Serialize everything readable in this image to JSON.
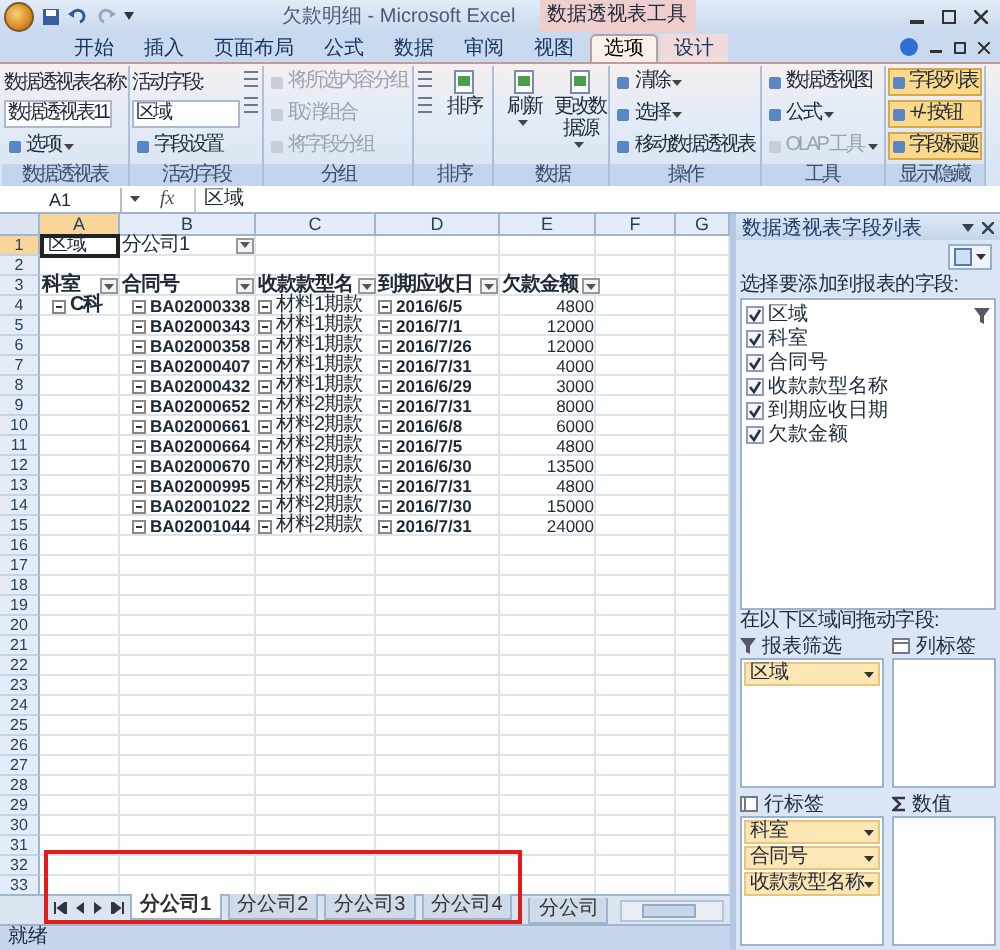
{
  "window": {
    "title": "欠款明细 - Microsoft Excel",
    "contextual_title": "数据透视表工具"
  },
  "ribbon_tabs": [
    {
      "label": "开始",
      "selected": false,
      "contextual": false
    },
    {
      "label": "插入",
      "selected": false,
      "contextual": false
    },
    {
      "label": "页面布局",
      "selected": false,
      "contextual": false
    },
    {
      "label": "公式",
      "selected": false,
      "contextual": false
    },
    {
      "label": "数据",
      "selected": false,
      "contextual": false
    },
    {
      "label": "审阅",
      "selected": false,
      "contextual": false
    },
    {
      "label": "视图",
      "selected": false,
      "contextual": false
    },
    {
      "label": "选项",
      "selected": true,
      "contextual": true
    },
    {
      "label": "设计",
      "selected": false,
      "contextual": true
    }
  ],
  "ribbon_groups": [
    {
      "label": "数据透视表",
      "columns": [
        [
          {
            "kind": "text",
            "label": "数据透视表名称:"
          },
          {
            "kind": "field",
            "value": "数据透视表11"
          },
          {
            "kind": "button",
            "label": "选项",
            "dropdown": true,
            "disabled": false,
            "selected": false
          }
        ]
      ]
    },
    {
      "label": "活动字段",
      "columns": [
        [
          {
            "kind": "text",
            "label": "活动字段:"
          },
          {
            "kind": "field",
            "value": "区域"
          },
          {
            "kind": "button",
            "label": "字段设置",
            "dropdown": false,
            "disabled": false,
            "selected": false
          }
        ],
        [
          {
            "kind": "icon"
          },
          {
            "kind": "icon"
          }
        ]
      ]
    },
    {
      "label": "分组",
      "columns": [
        [
          {
            "kind": "button",
            "label": "将所选内容分组",
            "dropdown": false,
            "disabled": true,
            "selected": false
          },
          {
            "kind": "button",
            "label": "取消组合",
            "dropdown": false,
            "disabled": true,
            "selected": false
          },
          {
            "kind": "button",
            "label": "将字段分组",
            "dropdown": false,
            "disabled": true,
            "selected": false
          }
        ]
      ]
    },
    {
      "label": "排序",
      "columns": [
        [
          {
            "kind": "icon"
          },
          {
            "kind": "icon"
          }
        ],
        [
          {
            "kind": "large",
            "label": "排序",
            "dropdown": false
          }
        ]
      ]
    },
    {
      "label": "数据",
      "columns": [
        [
          {
            "kind": "large",
            "label": "刷新",
            "dropdown": true
          }
        ],
        [
          {
            "kind": "large",
            "label": "更改数据源",
            "dropdown": true
          }
        ]
      ]
    },
    {
      "label": "操作",
      "columns": [
        [
          {
            "kind": "button",
            "label": "清除",
            "dropdown": true,
            "disabled": false,
            "selected": false
          },
          {
            "kind": "button",
            "label": "选择",
            "dropdown": true,
            "disabled": false,
            "selected": false
          },
          {
            "kind": "button",
            "label": "移动数据透视表",
            "dropdown": false,
            "disabled": false,
            "selected": false
          }
        ]
      ]
    },
    {
      "label": "工具",
      "columns": [
        [
          {
            "kind": "button",
            "label": "数据透视图",
            "dropdown": false,
            "disabled": false,
            "selected": false
          },
          {
            "kind": "button",
            "label": "公式",
            "dropdown": true,
            "disabled": false,
            "selected": false
          },
          {
            "kind": "button",
            "label": "OLAP 工具",
            "dropdown": true,
            "disabled": true,
            "selected": false
          }
        ]
      ]
    },
    {
      "label": "显示/隐藏",
      "columns": [
        [
          {
            "kind": "button",
            "label": "字段列表",
            "dropdown": false,
            "disabled": false,
            "selected": true
          },
          {
            "kind": "button",
            "label": "+/- 按钮",
            "dropdown": false,
            "disabled": false,
            "selected": true
          },
          {
            "kind": "button",
            "label": "字段标题",
            "dropdown": false,
            "disabled": false,
            "selected": true
          }
        ]
      ]
    }
  ],
  "formula_bar": {
    "name_box": "A1",
    "fx": "fx",
    "value": "区域"
  },
  "sheet": {
    "columns": [
      {
        "label": "A",
        "selected": true
      },
      {
        "label": "B",
        "selected": false
      },
      {
        "label": "C",
        "selected": false
      },
      {
        "label": "D",
        "selected": false
      },
      {
        "label": "E",
        "selected": false
      },
      {
        "label": "F",
        "selected": false
      },
      {
        "label": "G",
        "selected": false
      }
    ],
    "rows": [
      {
        "label": "1",
        "selected": true
      },
      {
        "label": "2",
        "selected": false
      },
      {
        "label": "3",
        "selected": false
      },
      {
        "label": "4",
        "selected": false
      },
      {
        "label": "5",
        "selected": false
      },
      {
        "label": "6",
        "selected": false
      },
      {
        "label": "7",
        "selected": false
      },
      {
        "label": "8",
        "selected": false
      },
      {
        "label": "9",
        "selected": false
      },
      {
        "label": "10",
        "selected": false
      },
      {
        "label": "11",
        "selected": false
      },
      {
        "label": "12",
        "selected": false
      },
      {
        "label": "13",
        "selected": false
      },
      {
        "label": "14",
        "selected": false
      },
      {
        "label": "15",
        "selected": false
      },
      {
        "label": "16",
        "selected": false
      },
      {
        "label": "17",
        "selected": false
      },
      {
        "label": "18",
        "selected": false
      },
      {
        "label": "19",
        "selected": false
      },
      {
        "label": "20",
        "selected": false
      },
      {
        "label": "21",
        "selected": false
      },
      {
        "label": "22",
        "selected": false
      },
      {
        "label": "23",
        "selected": false
      },
      {
        "label": "24",
        "selected": false
      },
      {
        "label": "25",
        "selected": false
      },
      {
        "label": "26",
        "selected": false
      },
      {
        "label": "27",
        "selected": false
      },
      {
        "label": "28",
        "selected": false
      },
      {
        "label": "29",
        "selected": false
      },
      {
        "label": "30",
        "selected": false
      },
      {
        "label": "31",
        "selected": false
      },
      {
        "label": "32",
        "selected": false
      },
      {
        "label": "33",
        "selected": false
      }
    ],
    "tabs": [
      {
        "label": "分公司1",
        "selected": true
      },
      {
        "label": "分公司2",
        "selected": false
      },
      {
        "label": "分公司3",
        "selected": false
      },
      {
        "label": "分公司4",
        "selected": false
      },
      {
        "label": "分公司",
        "selected": false
      }
    ]
  },
  "pivot": {
    "filter": {
      "field": "区域",
      "value": "分公司1"
    },
    "headers": [
      "科室",
      "合同号",
      "收款款型名",
      "到期应收日",
      "欠款金额"
    ],
    "group": "C科",
    "records": [
      {
        "contract": "BA02000338",
        "type": "材料1期款",
        "date": "2016/6/5",
        "amount": "4800"
      },
      {
        "contract": "BA02000343",
        "type": "材料1期款",
        "date": "2016/7/1",
        "amount": "12000"
      },
      {
        "contract": "BA02000358",
        "type": "材料1期款",
        "date": "2016/7/26",
        "amount": "12000"
      },
      {
        "contract": "BA02000407",
        "type": "材料1期款",
        "date": "2016/7/31",
        "amount": "4000"
      },
      {
        "contract": "BA02000432",
        "type": "材料1期款",
        "date": "2016/6/29",
        "amount": "3000"
      },
      {
        "contract": "BA02000652",
        "type": "材料2期款",
        "date": "2016/7/31",
        "amount": "8000"
      },
      {
        "contract": "BA02000661",
        "type": "材料2期款",
        "date": "2016/6/8",
        "amount": "6000"
      },
      {
        "contract": "BA02000664",
        "type": "材料2期款",
        "date": "2016/7/5",
        "amount": "4800"
      },
      {
        "contract": "BA02000670",
        "type": "材料2期款",
        "date": "2016/6/30",
        "amount": "13500"
      },
      {
        "contract": "BA02000995",
        "type": "材料2期款",
        "date": "2016/7/31",
        "amount": "4800"
      },
      {
        "contract": "BA02001022",
        "type": "材料2期款",
        "date": "2016/7/30",
        "amount": "15000"
      },
      {
        "contract": "BA02001044",
        "type": "材料2期款",
        "date": "2016/7/31",
        "amount": "24000"
      }
    ]
  },
  "status_bar": {
    "text": "就绪"
  },
  "field_list": {
    "title": "数据透视表字段列表",
    "choose_label": "选择要添加到报表的字段:",
    "fields": [
      {
        "name": "区域",
        "checked": true,
        "filtered": true
      },
      {
        "name": "科室",
        "checked": true,
        "filtered": false
      },
      {
        "name": "合同号",
        "checked": true,
        "filtered": false
      },
      {
        "name": "收款款型名称",
        "checked": true,
        "filtered": false
      },
      {
        "name": "到期应收日期",
        "checked": true,
        "filtered": false
      },
      {
        "name": "欠款金额",
        "checked": true,
        "filtered": false
      }
    ],
    "drag_label": "在以下区域间拖动字段:",
    "areas": [
      {
        "kind": "filter",
        "label": "报表筛选",
        "chips": [
          "区域"
        ]
      },
      {
        "kind": "columns",
        "label": "列标签"
      },
      {
        "kind": "rows",
        "label": "行标签",
        "chips": [
          "科室",
          "合同号",
          "收款款型名称"
        ]
      },
      {
        "kind": "values",
        "label": "数值"
      }
    ]
  }
}
